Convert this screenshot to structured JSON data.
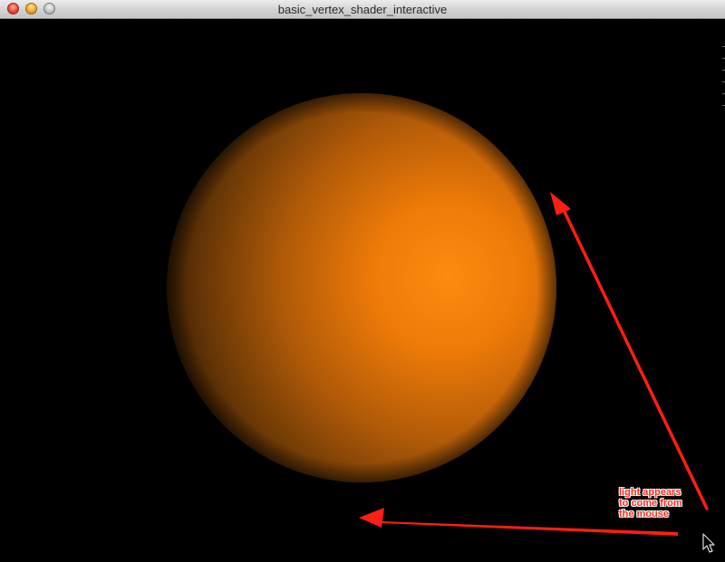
{
  "window": {
    "title": "basic_vertex_shader_interactive",
    "controls": [
      "close-icon",
      "minimize-icon",
      "zoom-icon"
    ]
  },
  "scene": {
    "object": "sphere",
    "sphere_color": "#ff7a00",
    "background_color": "#000000"
  },
  "annotation": {
    "lines": [
      "light appears",
      "to come from",
      "the mouse"
    ],
    "arrow_color": "#ff1e12",
    "text_color": "#ff2a1a"
  },
  "cursor": {
    "icon": "mouse-pointer-icon"
  }
}
